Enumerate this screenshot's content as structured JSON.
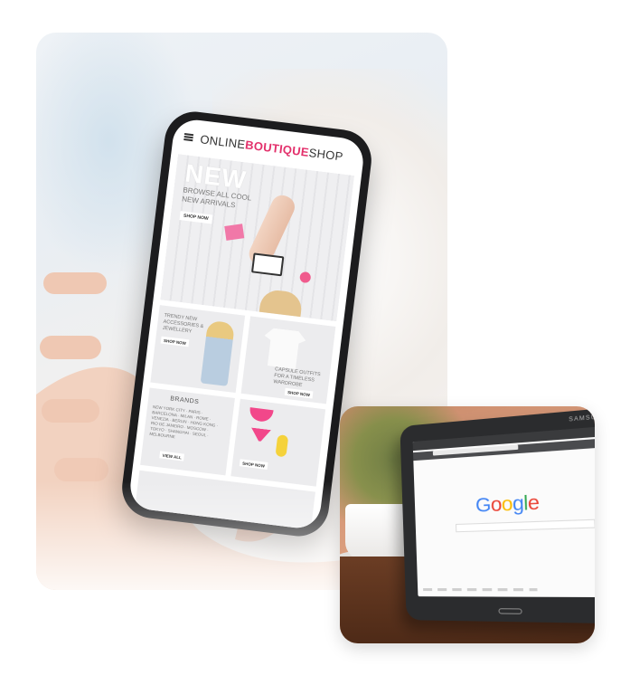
{
  "phone_app": {
    "header": {
      "title_prefix": "ONLINE ",
      "title_accent": "BOUTIQUE",
      "title_suffix": " SHOP"
    },
    "hero": {
      "headline": "NEW",
      "subtitle": "BROWSE ALL COOL NEW ARRIVALS",
      "button": "SHOP NOW"
    },
    "tiles": [
      {
        "text": "TRENDY NEW ACCESSORIES & JEWELLERY",
        "button": "SHOP NOW"
      },
      {
        "text": "CAPSULE OUTFITS FOR A TIMELESS WARDROBE",
        "button": "SHOP NOW"
      },
      {
        "heading": "BRANDS",
        "text": "NEW YORK CITY · PARIS · BARCELONA · MILAN · ROME · VENEZIA · BERLIN · HONG KONG · RIO DE JANEIRO · MOSCOW · TOKYO · SHANGHAI · SEOUL · MELBOURNE",
        "button": "VIEW ALL"
      },
      {
        "button": "SHOP NOW"
      }
    ]
  },
  "tablet": {
    "brand": "SAMSUNG",
    "logo": [
      "G",
      "o",
      "o",
      "g",
      "l",
      "e"
    ]
  },
  "colors": {
    "accent": "#e3306b",
    "google_blue": "#4285f4",
    "google_red": "#ea4335",
    "google_yellow": "#fbbc05",
    "google_green": "#34a853"
  }
}
